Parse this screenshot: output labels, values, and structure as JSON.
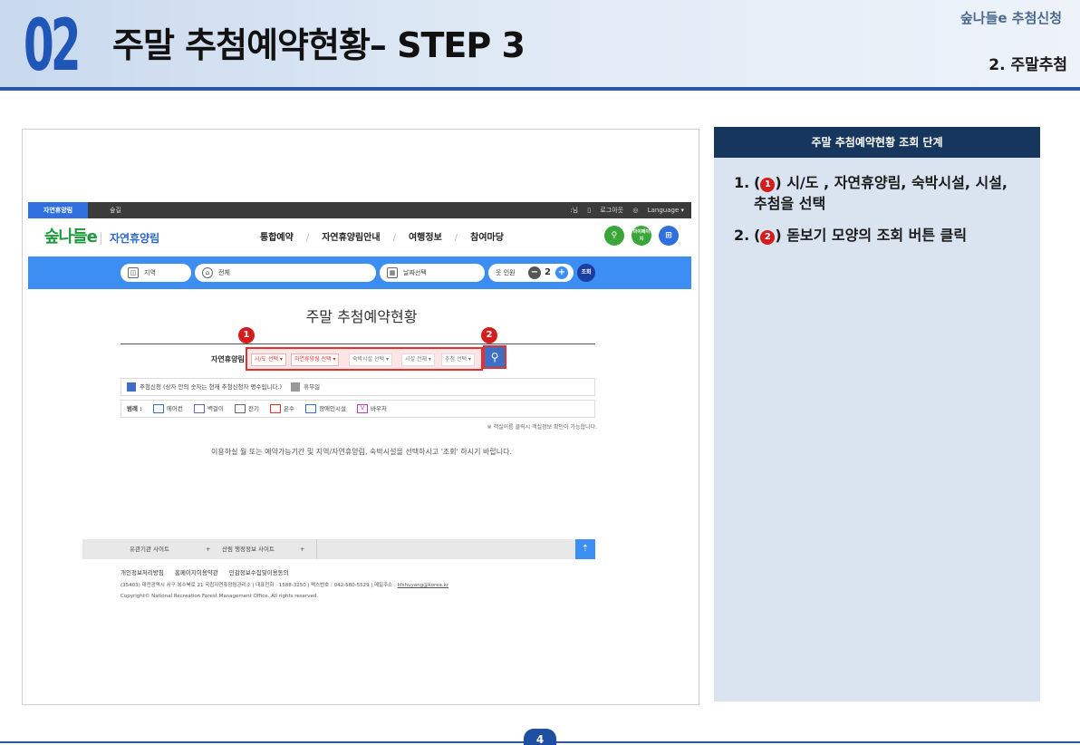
{
  "header": {
    "number": "02",
    "title": "주말 추첨예약현황– STEP 3",
    "subtitle_top": "숲나들e 추첨신청",
    "subtitle_bottom": "2. 주말추첨"
  },
  "site": {
    "topbar": {
      "active_tab": "자연휴양림",
      "tab2": "숲길",
      "util_user": ":님",
      "util_logout": "로그아웃",
      "util_language": "Language"
    },
    "logo": "숲나들e",
    "logo_text": "자연휴양림",
    "menu": [
      "통합예약",
      "자연휴양림안내",
      "여행정보",
      "참여마당"
    ],
    "menu_separator": "/",
    "nav_icons": [
      "search-icon",
      "mypage-icon",
      "grid-menu-icon"
    ],
    "nav_mypage_label": "마이페이지",
    "searchbar": {
      "region": "지역",
      "facility": "전체",
      "date": "날짜선택",
      "people_label": "인원",
      "people_count": "2",
      "search_button": "조회"
    },
    "page_heading": "주말 추첨예약현황",
    "filter": {
      "label": "자연휴양림",
      "selects": [
        "시/도 선택",
        "자연휴양림 선택",
        "숙박시설 선택",
        "시설 전체",
        "추첨 선택"
      ]
    },
    "badges": [
      "1",
      "2"
    ],
    "legend1": {
      "text": "추첨신청 (상자 안의 숫자는 현재 추첨신청자 명수입니다.)",
      "holiday": "휴무일"
    },
    "legend2": {
      "label": "범례 :",
      "items": [
        "에어컨",
        "벽걸이",
        "전기",
        "온수",
        "장애인시설",
        "바우처"
      ]
    },
    "note": "※ 객실이름 클릭시 객실정보 확인이 가능합니다.",
    "info_message": "이용하실 월 또는 예약가능기간 및 지역/자연휴양림, 숙박시설을 선택하시고 '조회' 하시기 바랍니다.",
    "footer": {
      "link1": "유관기관 사이트",
      "link2": "산림 행정정보 사이트",
      "plus": "+",
      "links": [
        "개인정보처리방침",
        "홈페이지이용약관",
        "민감정보수집및이용동의"
      ],
      "address": "(35403) 대전광역시 서구 복수북로 21 국립자연휴양림관리소  |  대표전화 : 1588-3250  |  팩스번호 : 042-580-5529  |  메일주소 :",
      "email": "kfshuyang@korea.kr",
      "copyright": "Copyright© National Recreation Forest Management Office. All rights reserved."
    }
  },
  "panel": {
    "title": "주말 추첨예약현황 조회 단계",
    "steps": [
      {
        "num": "1.",
        "badge": "1",
        "pre": "(",
        "post": ") 시/도 , 자연휴양림, 숙박시설, 시설, 추첨을 선택"
      },
      {
        "num": "2.",
        "badge": "2",
        "pre": "(",
        "post": ") 돋보기 모양의 조회 버튼 클릭"
      }
    ]
  },
  "page_number": "4",
  "colors": {
    "brand_blue": "#2b57a6",
    "search_blue": "#3d8ef2",
    "badge_red": "#d41c1c",
    "panel_navy": "#17365d",
    "panel_bg": "#dae3f0",
    "logo_green": "#1d9a3a"
  }
}
